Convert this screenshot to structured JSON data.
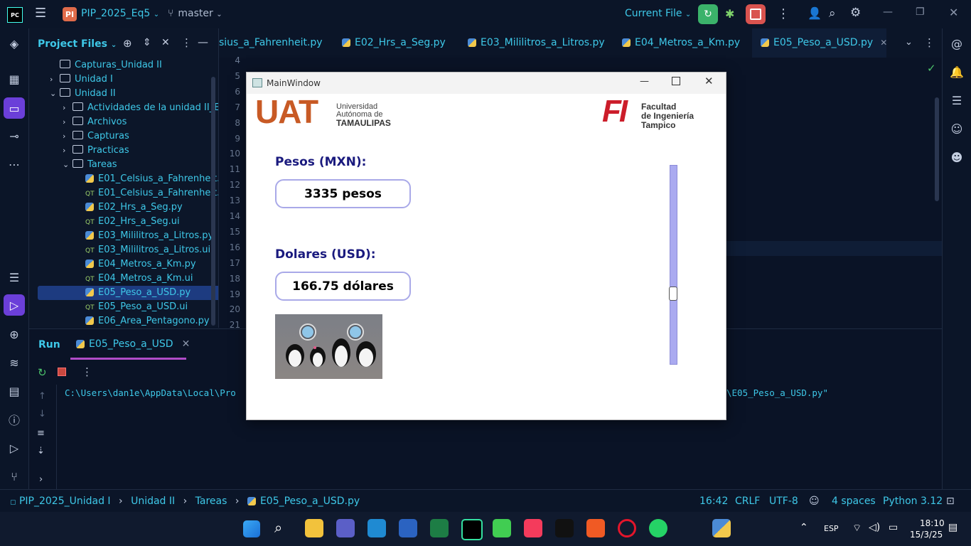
{
  "titlebar": {
    "app_badge": "PC",
    "project_badge": "PI",
    "project_name": "PIP_2025_Eq5",
    "branch": "master",
    "run_config": "Current File"
  },
  "project_panel": {
    "title": "Project Files",
    "items": [
      {
        "label": "Capturas_Unidad II",
        "type": "folder",
        "indent": 0,
        "arrow": ""
      },
      {
        "label": "Unidad I",
        "type": "folder",
        "indent": 0,
        "arrow": "›"
      },
      {
        "label": "Unidad II",
        "type": "folder",
        "indent": 0,
        "arrow": "⌄"
      },
      {
        "label": "Actividades de la unidad II_Equ",
        "type": "folder",
        "indent": 1,
        "arrow": "›"
      },
      {
        "label": "Archivos",
        "type": "folder",
        "indent": 1,
        "arrow": "›"
      },
      {
        "label": "Capturas",
        "type": "folder",
        "indent": 1,
        "arrow": "›"
      },
      {
        "label": "Practicas",
        "type": "folder",
        "indent": 1,
        "arrow": "›"
      },
      {
        "label": "Tareas",
        "type": "folder",
        "indent": 1,
        "arrow": "⌄"
      },
      {
        "label": "E01_Celsius_a_Fahrenheit.p",
        "type": "py",
        "indent": 2,
        "arrow": ""
      },
      {
        "label": "E01_Celsius_a_Fahrenheit.u",
        "type": "qt",
        "indent": 2,
        "arrow": ""
      },
      {
        "label": "E02_Hrs_a_Seg.py",
        "type": "py",
        "indent": 2,
        "arrow": ""
      },
      {
        "label": "E02_Hrs_a_Seg.ui",
        "type": "qt",
        "indent": 2,
        "arrow": ""
      },
      {
        "label": "E03_Mililitros_a_Litros.py",
        "type": "py",
        "indent": 2,
        "arrow": ""
      },
      {
        "label": "E03_Mililitros_a_Litros.ui",
        "type": "qt",
        "indent": 2,
        "arrow": ""
      },
      {
        "label": "E04_Metros_a_Km.py",
        "type": "py",
        "indent": 2,
        "arrow": ""
      },
      {
        "label": "E04_Metros_a_Km.ui",
        "type": "qt",
        "indent": 2,
        "arrow": ""
      },
      {
        "label": "E05_Peso_a_USD.py",
        "type": "py",
        "indent": 2,
        "arrow": "",
        "selected": true
      },
      {
        "label": "E05_Peso_a_USD.ui",
        "type": "qt",
        "indent": 2,
        "arrow": ""
      },
      {
        "label": "E06_Area_Pentagono.py",
        "type": "py",
        "indent": 2,
        "arrow": ""
      }
    ]
  },
  "tabs": [
    {
      "label": "sius_a_Fahrenheit.py"
    },
    {
      "label": "E02_Hrs_a_Seg.py"
    },
    {
      "label": "E03_Mililitros_a_Litros.py"
    },
    {
      "label": "E04_Metros_a_Km.py"
    },
    {
      "label": "E05_Peso_a_USD.py",
      "active": true
    }
  ],
  "line_numbers": [
    "4",
    "5",
    "6",
    "7",
    "8",
    "9",
    "10",
    "11",
    "12",
    "13",
    "14",
    "15",
    "16",
    "17",
    "18",
    "19",
    "20",
    "21"
  ],
  "run_panel": {
    "title": "Run",
    "tab_label": "E05_Peso_a_USD",
    "command_left": "C:\\Users\\dan1e\\AppData\\Local\\Pro",
    "command_right": "\\E05_Peso_a_USD.py\""
  },
  "statusbar": {
    "breadcrumb": [
      "PIP_2025_Unidad I",
      "Unidad II",
      "Tareas",
      "E05_Peso_a_USD.py"
    ],
    "position": "16:42",
    "line_ending": "CRLF",
    "encoding": "UTF-8",
    "indent": "4 spaces",
    "interpreter": "Python 3.12"
  },
  "mainwindow": {
    "title": "MainWindow",
    "logo_left": {
      "big": "UAT",
      "line1": "Universidad",
      "line2": "Autónoma de",
      "line3": "TAMAULIPAS"
    },
    "logo_right": {
      "big": "FI",
      "line1": "Facultad",
      "line2": "de Ingeniería",
      "line3": "Tampico"
    },
    "pesos_label": "Pesos (MXN):",
    "pesos_value": "3335 pesos",
    "dolares_label": "Dolares (USD):",
    "dolares_value": "166.75 dólares",
    "slider_fraction": 0.35
  },
  "taskbar": {
    "lang": "ESP",
    "time": "18:10",
    "date": "15/3/25"
  },
  "colors": {
    "accent": "#3ec8e8",
    "label_blue": "#1a1a7e",
    "field_border": "#a9a9e8",
    "slider": "#aaaaf0"
  }
}
